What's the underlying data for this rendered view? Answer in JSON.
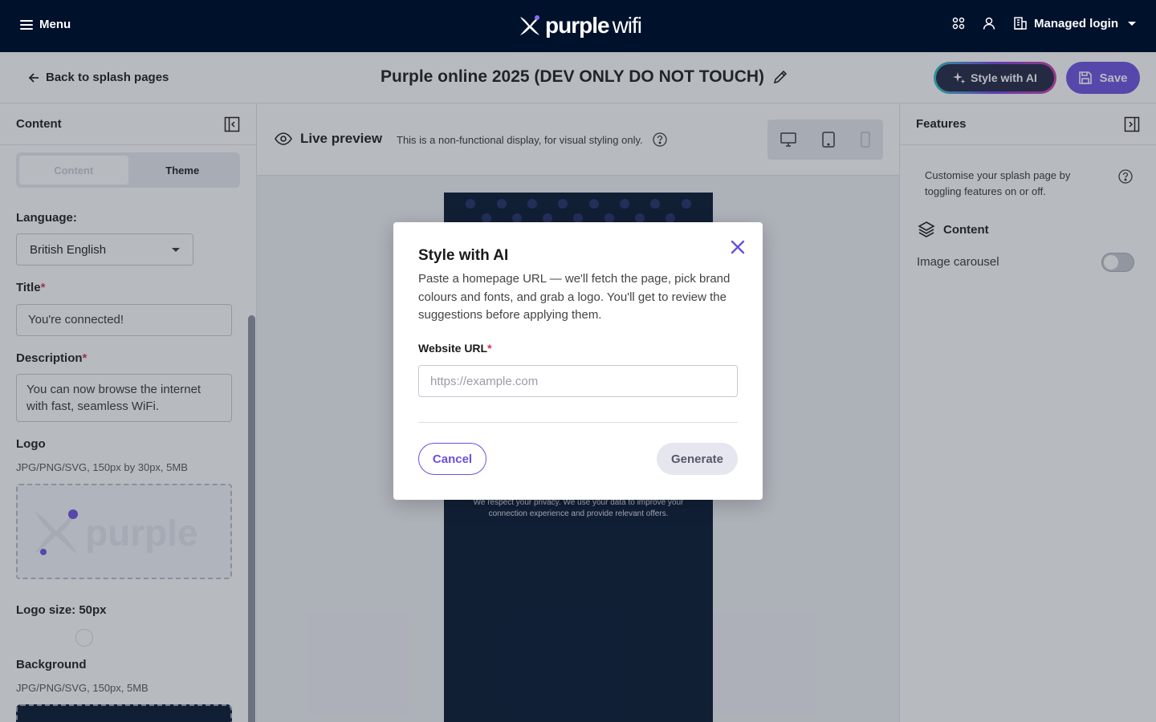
{
  "topbar": {
    "menu_label": "Menu",
    "brand_bold": "purple",
    "brand_light": "wifi",
    "account_label": "Managed login"
  },
  "subheader": {
    "back_label": "Back to splash pages",
    "title": "Purple online 2025 (DEV ONLY DO NOT TOUCH)",
    "ai_button": "Style with AI",
    "save_button": "Save"
  },
  "left_panel": {
    "header": "Content",
    "tabs": [
      {
        "label": "Content",
        "active": true
      },
      {
        "label": "Theme",
        "active": false
      }
    ],
    "language_label": "Language:",
    "language_value": "British English",
    "title_label": "Title",
    "title_value": "You're connected!",
    "description_label": "Description",
    "description_value": "You can now browse the internet with fast, seamless WiFi.",
    "logo_label": "Logo",
    "logo_hint": "JPG/PNG/SVG, 150px by 30px, 5MB",
    "logo_size_label": "Logo size: 50px",
    "background_label": "Background",
    "background_hint": "JPG/PNG/SVG, 150px, 5MB"
  },
  "preview": {
    "title": "Live preview",
    "note": "This is a non-functional display, for visual styling only.",
    "devices": [
      "desktop-icon",
      "tablet-icon",
      "mobile-icon"
    ],
    "privacy_text": "We respect your privacy. We use your data to improve your connection experience and provide relevant offers."
  },
  "right_panel": {
    "header": "Features",
    "description": "Customise your splash page by toggling features on or off.",
    "section_label": "Content",
    "carousel_label": "Image carousel",
    "carousel_enabled": false
  },
  "modal": {
    "title": "Style with AI",
    "description": "Paste a homepage URL — we'll fetch the page, pick brand colours and fonts, and grab a logo. You'll get to review the suggestions before applying them.",
    "url_label": "Website URL",
    "url_placeholder": "https://example.com",
    "url_value": "",
    "cancel_label": "Cancel",
    "generate_label": "Generate"
  },
  "colors": {
    "navy": "#00112c",
    "accent": "#6b4fe0",
    "required": "#d9304a"
  }
}
